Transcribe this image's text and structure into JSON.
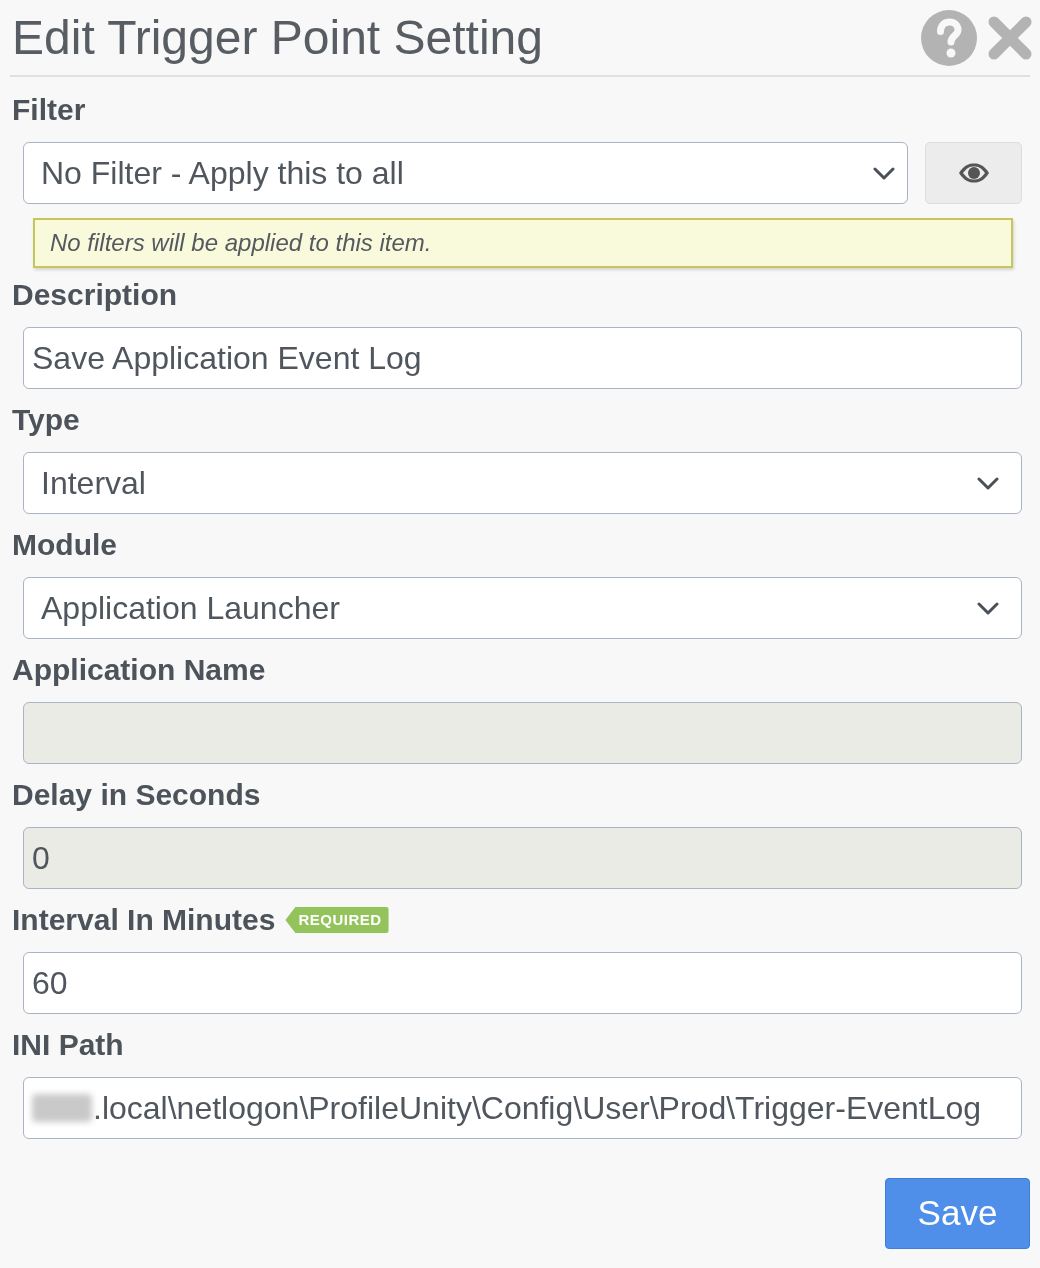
{
  "dialog": {
    "title": "Edit Trigger Point Setting"
  },
  "filter": {
    "label": "Filter",
    "value": "No Filter - Apply this to all",
    "hint": "No filters will be applied to this item."
  },
  "fields": [
    {
      "label": "Description",
      "kind": "text",
      "value": "Save Application Event Log",
      "disabled": false
    },
    {
      "label": "Type",
      "kind": "select",
      "value": "Interval",
      "disabled": false
    },
    {
      "label": "Module",
      "kind": "select",
      "value": "Application Launcher",
      "disabled": false
    },
    {
      "label": "Application Name",
      "kind": "text",
      "disabled": true
    },
    {
      "label": "Delay in Seconds",
      "kind": "text",
      "value": "0",
      "disabled": true
    },
    {
      "label": "Interval In Minutes",
      "kind": "text",
      "value": "60",
      "disabled": false,
      "badge": "REQUIRED"
    },
    {
      "label": "INI Path",
      "kind": "text",
      "value": ".local\\netlogon\\ProfileUnity\\Config\\User\\Prod\\Trigger-EventLog",
      "disabled": false,
      "redacted": true
    }
  ],
  "save_button": "Save"
}
